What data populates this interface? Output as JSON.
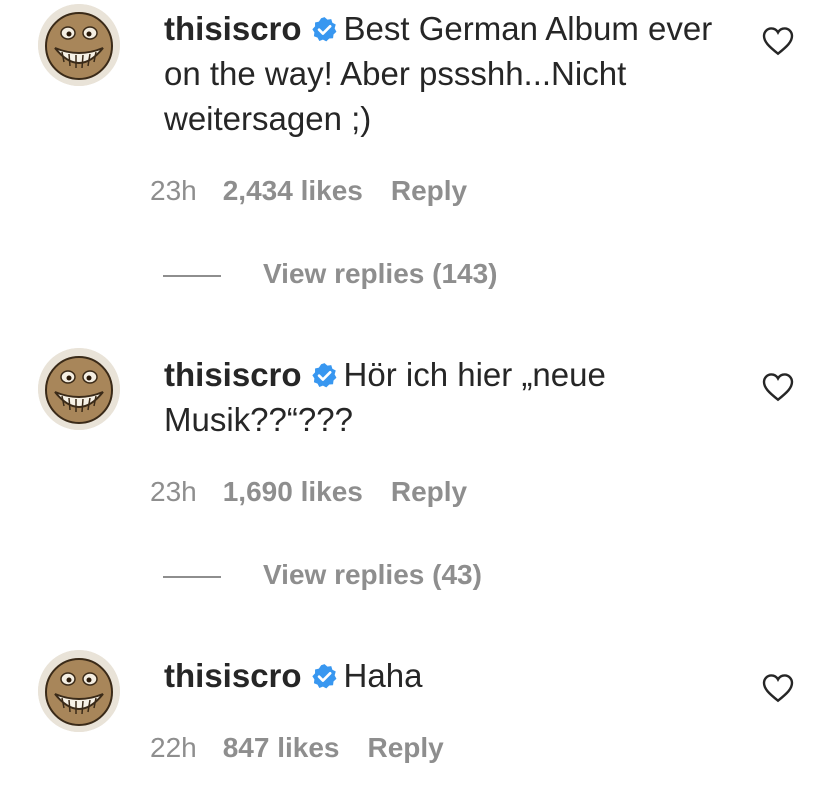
{
  "comments": [
    {
      "username": "thisiscro",
      "text": "Best German Album ever on the way! Aber pssshh...Nicht weitersagen ;)",
      "time": "23h",
      "likes": "2,434 likes",
      "reply_label": "Reply",
      "view_replies": "View replies (143)"
    },
    {
      "username": "thisiscro",
      "text": "Hör ich hier „neue Musik??“???",
      "time": "23h",
      "likes": "1,690 likes",
      "reply_label": "Reply",
      "view_replies": "View replies (43)"
    },
    {
      "username": "thisiscro",
      "text": "Haha",
      "time": "22h",
      "likes": "847 likes",
      "reply_label": "Reply"
    }
  ],
  "colors": {
    "text": "#262626",
    "secondary": "#8e8e8e",
    "verified_badge": "#3897f0"
  },
  "icons": {
    "avatar": "smiley-face-avatar",
    "verified": "verified-badge-icon",
    "like": "heart-outline-icon"
  }
}
